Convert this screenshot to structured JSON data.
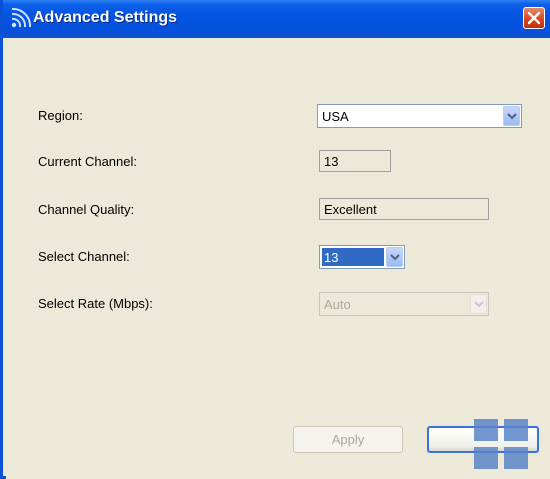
{
  "window": {
    "title": "Advanced Settings",
    "icons": {
      "app": "wireless-signal-icon",
      "close": "close-icon"
    },
    "colors": {
      "titlebar": "#0554e3",
      "background": "#ece9d8",
      "selection": "#316ac5"
    }
  },
  "form": {
    "region": {
      "label": "Region:",
      "value": "USA"
    },
    "current_channel": {
      "label": "Current Channel:",
      "value": "13"
    },
    "channel_quality": {
      "label": "Channel Quality:",
      "value": "Excellent"
    },
    "select_channel": {
      "label": "Select Channel:",
      "value": "13"
    },
    "select_rate": {
      "label": "Select Rate (Mbps):",
      "value": "Auto",
      "disabled": true
    }
  },
  "buttons": {
    "apply": {
      "label": "Apply",
      "disabled": true
    },
    "ok": {
      "label": ""
    }
  }
}
